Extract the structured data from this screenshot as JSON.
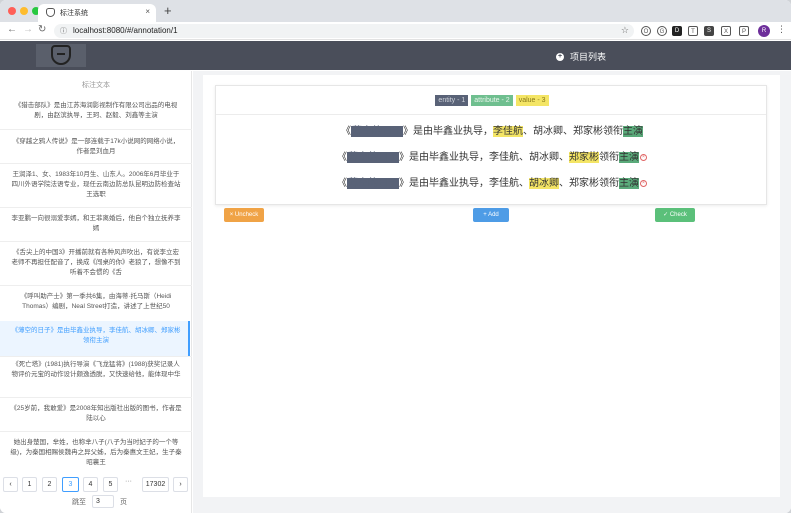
{
  "browser": {
    "tab_title": "标注系统",
    "tab_close": "×",
    "new_tab": "+",
    "url": "localhost:8080/#/annotation/1",
    "avatar_letter": "R",
    "extensions": [
      "O",
      "G",
      "D",
      "T",
      "S",
      "X",
      "P"
    ]
  },
  "header": {
    "project_list_label": "项目列表",
    "project_icon": "plus-circle-icon"
  },
  "sidebar": {
    "title": "标注文本",
    "items": [
      "《猎击部队》是由江苏海润影视制作有限公司出品的电视剧，由赵滨执导，王珂、赵毅、刘鑫等主演",
      "《穿越之鸦人传说》是一部连载于17k小说网的网络小说，作者是刘血月",
      "王润泽1、女、1983年10月生、山东人。2006年6月毕业于四川外语学院法语专业，现任云南边防总队昆明边防检查站王选职",
      "李亚鹏一向很溺爱李嫣，和王菲离婚后，他自个独立抚养李嫣",
      "《舌尖上的中国3》开播前就有各种风声吹出，有说李立宏老师不再担任配音了，换成《闯桌的你》老狼了，想像不到听着不会惯的《舌",
      "《呼叫助产士》第一季共6集，由海蒂·托马斯（Heidi Thomas）编剧，Neal Street打造，讲述了上世纪50",
      "《薄空的日子》是由毕鑫业执导，李佳航、胡冰卿、郑家彬领衔主演",
      "《死亡塔》(1981)执行导演《飞龙猛将》(1988)获奖记录人物评价元宝的动作设计颇逸透脱，又快速给他，能体现中华",
      "《25岁前，我敢爱》是2008年知出版社出版的图书，作者是陆以心",
      "她出身楚国，芈姓，也称芈八子(八子为当时妃子的一个等级)，为秦国相赐侯魏冉之异父姊，后为秦惠文王妃，生子秦昭襄王"
    ]
  },
  "pagination": {
    "prev": "‹",
    "next": "›",
    "pages": [
      "1",
      "2",
      "3",
      "4",
      "5"
    ],
    "dots": "···",
    "last": "17302",
    "current": "3",
    "jump_label": "跳至",
    "jump_value": "3",
    "jump_suffix": "页"
  },
  "annotation": {
    "labels": {
      "entity": "entity - 1",
      "attribute": "attribute - 2",
      "value": "value - 3"
    },
    "sentences": [
      {
        "pre": "《",
        "entity": "薄空的日子",
        "mid": "》是由毕鑫业执导，",
        "value": "李佳航",
        "post": "、胡冰卿、郑家彬领衔",
        "attr": "主演",
        "removable": false
      },
      {
        "pre": "《",
        "entity": "薄空的日子",
        "mid": "》是由毕鑫业执导，李佳航、胡冰卿、",
        "value": "郑家彬",
        "post": "领衔",
        "attr": "主演",
        "removable": true
      },
      {
        "pre": "《",
        "entity": "薄空的日子",
        "mid": "》是由毕鑫业执导，李佳航、",
        "value": "胡冰卿",
        "post": "、郑家彬领衔",
        "attr": "主演",
        "removable": true
      }
    ],
    "remove_mark": "×",
    "buttons": {
      "uncheck": "× Uncheck",
      "add": "+ Add",
      "check": "✓ Check"
    }
  },
  "colors": {
    "header_bg": "#4a4e5a",
    "entity": "#596277",
    "attribute": "#6fbf8f",
    "value": "#f4e565",
    "accent": "#409eff",
    "uncheck": "#f0a346",
    "add": "#4e9ce6",
    "check": "#5bc07a"
  }
}
